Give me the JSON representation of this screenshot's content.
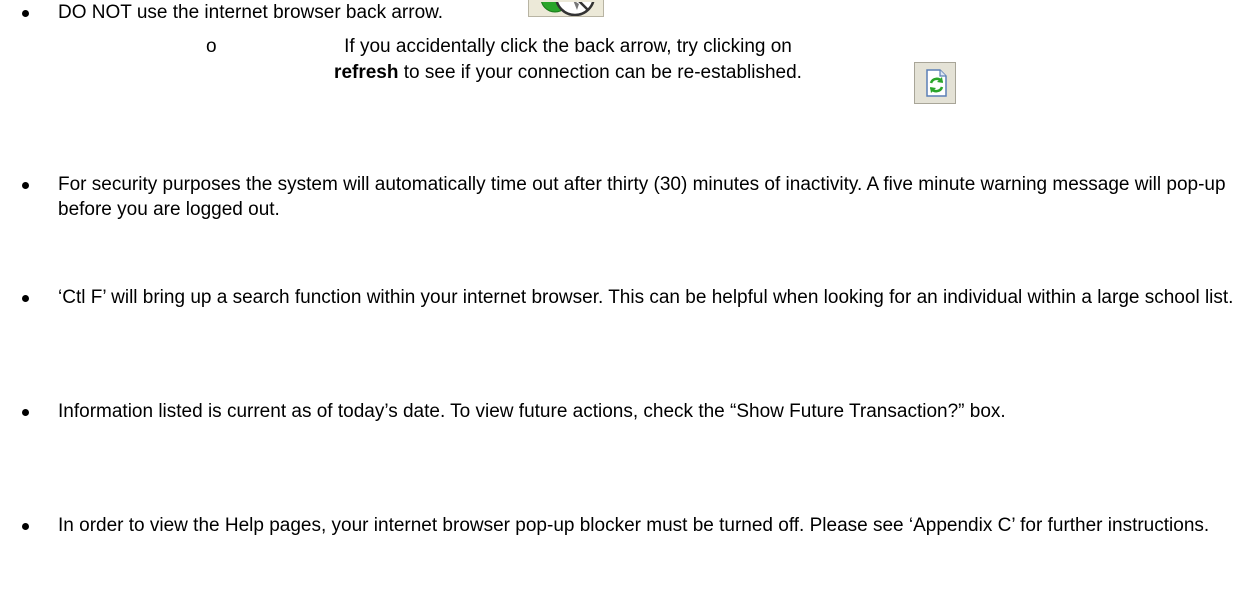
{
  "items": [
    {
      "text": "DO NOT use the internet browser back arrow."
    },
    {
      "text": "For security purposes the system will automatically time out after thirty (30) minutes of inactivity.  A five minute warning message will pop-up before you are logged out."
    },
    {
      "text": "‘Ctl F’ will bring up a search function within your internet browser.  This can be helpful when looking for an individual within a large school list."
    },
    {
      "text": "Information listed is current as of today’s date.  To view future actions, check the “Show Future Transaction?” box."
    },
    {
      "text": "In order to view the Help pages, your internet browser pop-up blocker must be turned off.  Please see ‘Appendix C’ for further instructions."
    }
  ],
  "sub_item": {
    "marker": "o",
    "line1": "If you accidentally click the back arrow, try clicking on",
    "bold": "refresh",
    "line2_rest": " to see if your connection can be re-established."
  },
  "icons": {
    "back_arrow": "back-arrow-prohibited-icon",
    "refresh": "refresh-icon"
  },
  "colors": {
    "text": "#000000",
    "icon_green": "#2aa52a"
  }
}
